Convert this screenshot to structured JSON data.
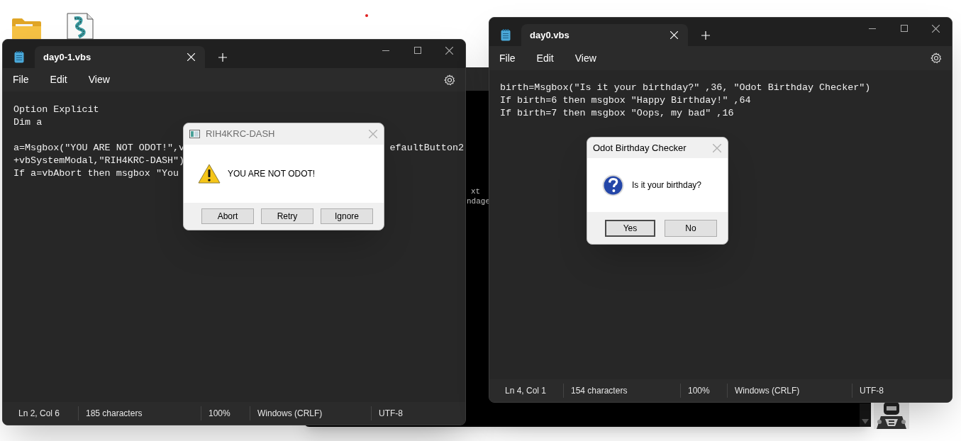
{
  "console": {
    "lines": [
      "xt",
      "ndage"
    ]
  },
  "windows": [
    {
      "tab": "day0-1.vbs",
      "menu": [
        "File",
        "Edit",
        "View"
      ],
      "lines": [
        {
          "segments": [
            "Option Explicit"
          ]
        },
        {
          "segments": [
            "Dim a"
          ]
        },
        {
          "segments": [
            "a=Msgbox(\"YOU ARE NOT ODOT!\",v",
            "efaultButton2"
          ],
          "blank_line_before": true
        },
        {
          "segments": [
            "+vbSystemModal,\"RIH4KRC-DASH\")"
          ]
        },
        {
          "segments": [
            "If a=vbAbort then msgbox \"You"
          ]
        }
      ],
      "status": [
        "Ln 2, Col 6",
        "185 characters",
        "100%",
        "Windows (CRLF)",
        "UTF-8"
      ],
      "dialog": {
        "title": "RIH4KRC-DASH",
        "message": "YOU ARE NOT ODOT!",
        "kind": "warning",
        "buttons": [
          {
            "label": "Abort",
            "default": false
          },
          {
            "label": "Retry",
            "default": false
          },
          {
            "label": "Ignore",
            "default": false
          }
        ]
      }
    },
    {
      "tab": "day0.vbs",
      "menu": [
        "File",
        "Edit",
        "View"
      ],
      "lines": [
        {
          "segments": [
            "birth=Msgbox(\"Is it your birthday?\" ,36, \"Odot Birthday Checker\")"
          ]
        },
        {
          "segments": [
            "If birth=6 then msgbox \"Happy Birthday!\" ,64"
          ]
        },
        {
          "segments": [
            "If birth=7 then msgbox \"Oops, my bad\" ,16"
          ]
        }
      ],
      "status": [
        "Ln 4, Col 1",
        "154 characters",
        "100%",
        "Windows (CRLF)",
        "UTF-8"
      ],
      "dialog": {
        "title": "Odot Birthday Checker",
        "message": "Is it your birthday?",
        "kind": "question",
        "buttons": [
          {
            "label": "Yes",
            "default": true
          },
          {
            "label": "No",
            "default": false
          }
        ]
      }
    }
  ]
}
